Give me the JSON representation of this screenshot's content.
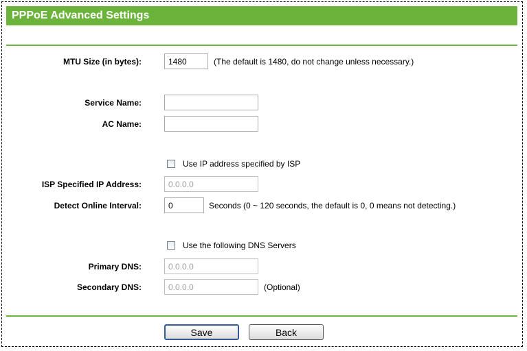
{
  "header": {
    "title": "PPPoE Advanced Settings"
  },
  "form": {
    "mtu": {
      "label": "MTU Size (in bytes):",
      "value": "1480",
      "hint": "(The default is 1480, do not change unless necessary.)"
    },
    "service_name": {
      "label": "Service Name:",
      "value": ""
    },
    "ac_name": {
      "label": "AC Name:",
      "value": ""
    },
    "use_isp_ip": {
      "label": "Use IP address specified by ISP",
      "checked": false
    },
    "isp_ip": {
      "label": "ISP Specified IP Address:",
      "value": "0.0.0.0"
    },
    "detect_interval": {
      "label": "Detect Online Interval:",
      "value": "0",
      "hint": "Seconds (0 ~ 120 seconds, the default is 0, 0 means not detecting.)"
    },
    "use_dns": {
      "label": "Use the following DNS Servers",
      "checked": false
    },
    "primary_dns": {
      "label": "Primary DNS:",
      "value": "0.0.0.0"
    },
    "secondary_dns": {
      "label": "Secondary DNS:",
      "value": "0.0.0.0",
      "hint": "(Optional)"
    }
  },
  "buttons": {
    "save_label": "Save",
    "back_label": "Back"
  },
  "colors": {
    "header_green": "#6bb33a",
    "primary_button_border": "#355b96"
  }
}
